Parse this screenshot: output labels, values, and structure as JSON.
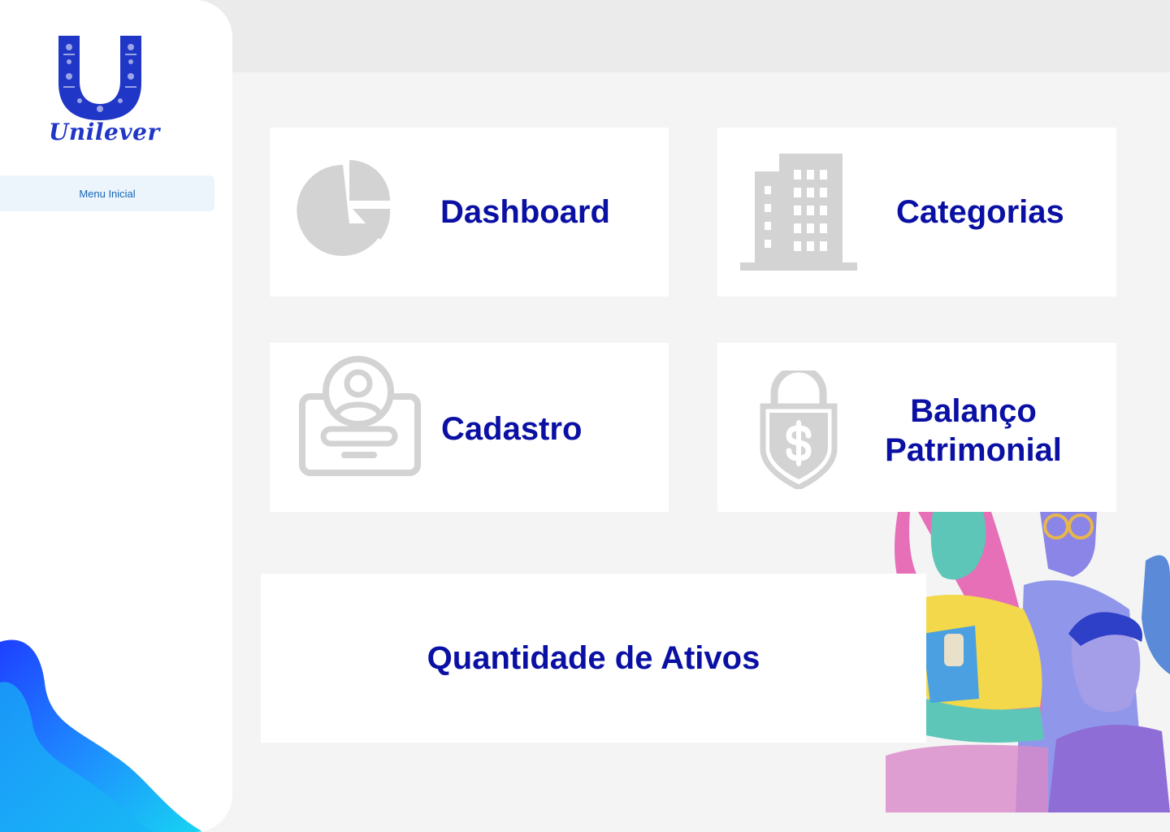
{
  "brand": {
    "name": "Unilever",
    "color": "#1f36c7"
  },
  "sidebar": {
    "menu_item": "Menu Inicial"
  },
  "cards": {
    "dashboard": {
      "label": "Dashboard",
      "icon": "pie-chart-icon"
    },
    "categorias": {
      "label": "Categorias",
      "icon": "building-icon"
    },
    "cadastro": {
      "label": "Cadastro",
      "icon": "id-card-icon"
    },
    "balanco": {
      "label_line1": "Balanço",
      "label_line2": "Patrimonial",
      "icon": "shield-dollar-icon"
    },
    "ativos": {
      "label": "Quantidade de Ativos"
    }
  },
  "colors": {
    "accent_text": "#0a10a3",
    "menu_active_bg": "#ecf4fc",
    "menu_active_text": "#1565b4",
    "icon_gray": "#d3d3d3"
  }
}
